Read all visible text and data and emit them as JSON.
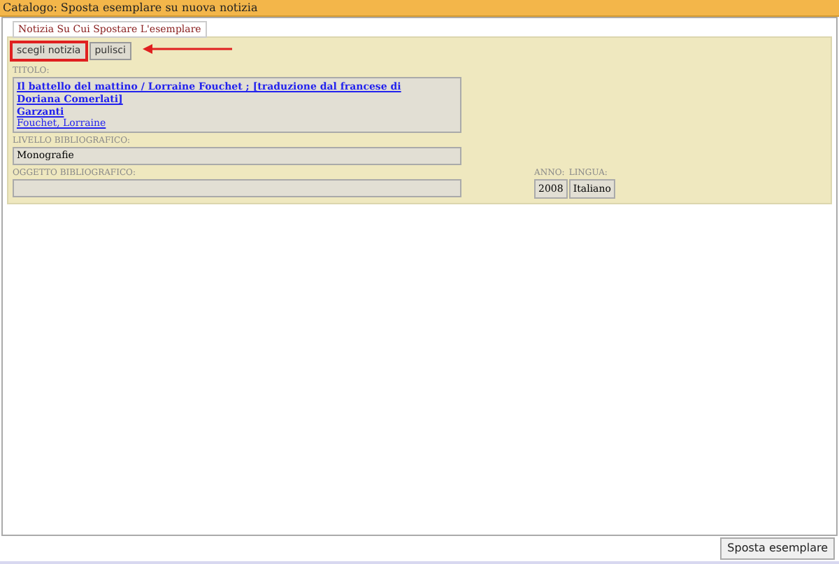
{
  "window": {
    "title": "Catalogo: Sposta esemplare su nuova notizia"
  },
  "section": {
    "legend": "Notizia Su Cui Spostare L'esemplare"
  },
  "buttons": [
    {
      "label": "scegli notizia",
      "highlighted": true
    },
    {
      "label": "pulisci",
      "highlighted": false
    }
  ],
  "record": {
    "titolo_label": "TITOLO:",
    "titolo_links": [
      "Il battello del mattino / Lorraine Fouchet ; [traduzione dal francese di",
      "Doriana Comerlati]",
      "Garzanti"
    ],
    "author": "Fouchet, Lorraine",
    "livello_label": "LIVELLO BIBLIOGRAFICO:",
    "livello": "Monografie",
    "oggetto_label": "OGGETTO BIBLIOGRAFICO:",
    "anno_label": "ANNO:",
    "anno": "2008",
    "lingua_label": "LINGUA:",
    "lingua": "Italiano"
  },
  "footer": {
    "button": "Sposta esemplare"
  }
}
